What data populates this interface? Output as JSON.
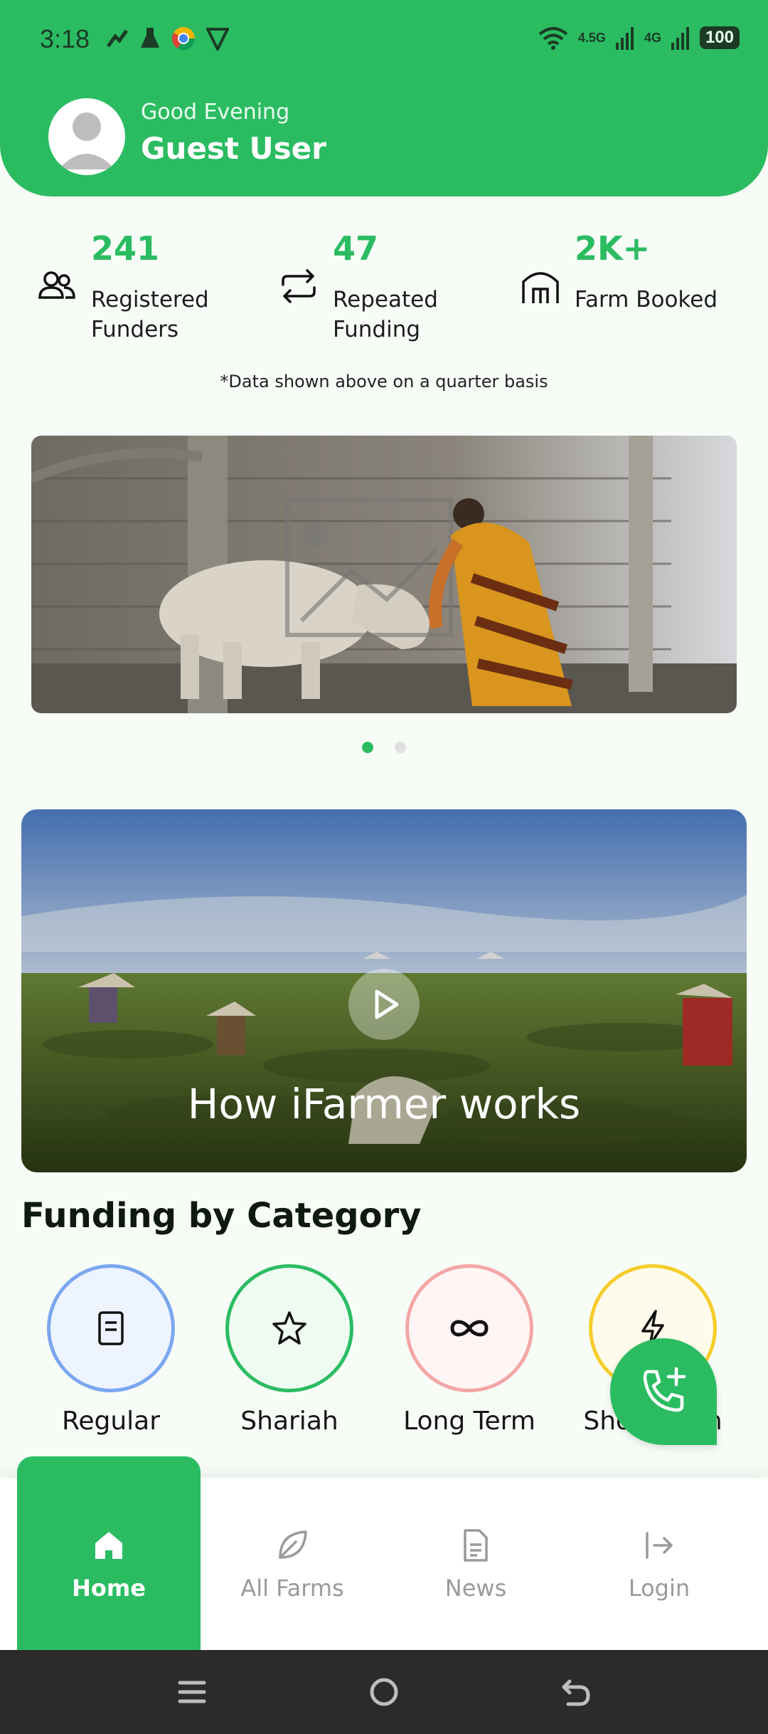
{
  "status_bar": {
    "time": "3:18",
    "net1": "4.5G",
    "net2": "4G",
    "battery": "100"
  },
  "header": {
    "greeting": "Good Evening",
    "user_name": "Guest User"
  },
  "stats": [
    {
      "value": "241",
      "label": "Registered Funders",
      "icon": "users-icon"
    },
    {
      "value": "47",
      "label": "Repeated Funding",
      "icon": "repeat-icon"
    },
    {
      "value": "2K+",
      "label": "Farm Booked",
      "icon": "farm-icon"
    }
  ],
  "stats_note": "*Data shown above on a quarter basis",
  "carousel": {
    "active_index": 0,
    "count": 2
  },
  "video": {
    "title": "How iFarmer works"
  },
  "category": {
    "title": "Funding by Category",
    "items": [
      {
        "label": "Regular",
        "icon": "document-icon",
        "color": "#7ba7f0",
        "bg": "#eef4ff"
      },
      {
        "label": "Shariah",
        "icon": "star-icon",
        "color": "#2bbc62",
        "bg": "#eefbf1"
      },
      {
        "label": "Long Term",
        "icon": "infinity-icon",
        "color": "#f4a6a6",
        "bg": "#fff5f5"
      },
      {
        "label": "Short Term",
        "icon": "lightning-icon",
        "color": "#f5cc2a",
        "bg": "#fffbea"
      }
    ]
  },
  "bottom_nav": [
    {
      "label": "Home",
      "icon": "home-icon",
      "active": true
    },
    {
      "label": "All Farms",
      "icon": "leaf-icon",
      "active": false
    },
    {
      "label": "News",
      "icon": "news-icon",
      "active": false
    },
    {
      "label": "Login",
      "icon": "login-icon",
      "active": false
    }
  ],
  "colors": {
    "accent": "#2bbc62",
    "background": "#f7fcf7",
    "system_nav": "#2b2b2b"
  }
}
